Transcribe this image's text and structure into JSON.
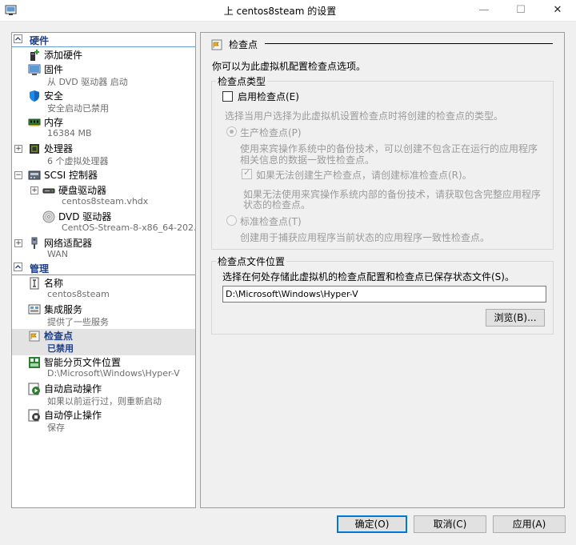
{
  "window": {
    "title": "上 centos8steam 的设置",
    "minimize_glyph": "—",
    "maximize_glyph": "☐",
    "close_glyph": "✕"
  },
  "sidebar": {
    "hardware_label": "硬件",
    "management_label": "管理",
    "hardware_items": [
      {
        "name": "添加硬件",
        "sub": "",
        "icon": "add-hardware-icon"
      },
      {
        "name": "固件",
        "sub": "从 DVD 驱动器 启动",
        "icon": "firmware-icon"
      },
      {
        "name": "安全",
        "sub": "安全启动已禁用",
        "icon": "shield-icon"
      },
      {
        "name": "内存",
        "sub": "16384 MB",
        "icon": "memory-icon"
      },
      {
        "name": "处理器",
        "sub": "6 个虚拟处理器",
        "icon": "processor-icon"
      },
      {
        "name": "SCSI 控制器",
        "sub": "",
        "icon": "scsi-icon"
      },
      {
        "name": "硬盘驱动器",
        "sub": "centos8steam.vhdx",
        "icon": "hard-drive-icon"
      },
      {
        "name": "DVD 驱动器",
        "sub": "CentOS-Stream-8-x86_64-202...",
        "icon": "dvd-icon"
      },
      {
        "name": "网络适配器",
        "sub": "WAN",
        "icon": "network-adapter-icon"
      }
    ],
    "management_items": [
      {
        "name": "名称",
        "sub": "centos8steam",
        "icon": "name-icon"
      },
      {
        "name": "集成服务",
        "sub": "提供了一些服务",
        "icon": "integration-icon"
      },
      {
        "name": "检查点",
        "sub": "已禁用",
        "icon": "checkpoint-icon"
      },
      {
        "name": "智能分页文件位置",
        "sub": "D:\\Microsoft\\Windows\\Hyper-V",
        "icon": "paging-icon"
      },
      {
        "name": "自动启动操作",
        "sub": "如果以前运行过，则重新启动",
        "icon": "auto-start-icon"
      },
      {
        "name": "自动停止操作",
        "sub": "保存",
        "icon": "auto-stop-icon"
      }
    ],
    "expander_plus": "+",
    "expander_minus": "−"
  },
  "panel": {
    "title": "检查点",
    "intro": "你可以为此虚拟机配置检查点选项。",
    "type_group": {
      "title": "检查点类型",
      "enable_label": "启用检查点(E)",
      "choose_text": "选择当用户选择为此虚拟机设置检查点时将创建的检查点的类型。",
      "production_label": "生产检查点(P)",
      "production_desc_1": "使用来宾操作系统中的备份技术，可以创建不包含正在运行的应用程序",
      "production_desc_2": "相关信息的数据一致性检查点。",
      "fallback_label": "如果无法创建生产检查点，请创建标准检查点(R)。",
      "fallback_desc_1": "如果无法使用来宾操作系统内部的备份技术，请获取包含完整应用程序",
      "fallback_desc_2": "状态的检查点。",
      "standard_label": "标准检查点(T)",
      "standard_desc": "创建用于捕获应用程序当前状态的应用程序一致性检查点。",
      "check_mark": "✓"
    },
    "location_group": {
      "title": "检查点文件位置",
      "description": "选择在何处存储此虚拟机的检查点配置和检查点已保存状态文件(S)。",
      "path_value": "D:\\Microsoft\\Windows\\Hyper-V",
      "browse_label": "浏览(B)..."
    }
  },
  "footer": {
    "ok_label": "确定(O)",
    "cancel_label": "取消(C)",
    "apply_label": "应用(A)"
  }
}
